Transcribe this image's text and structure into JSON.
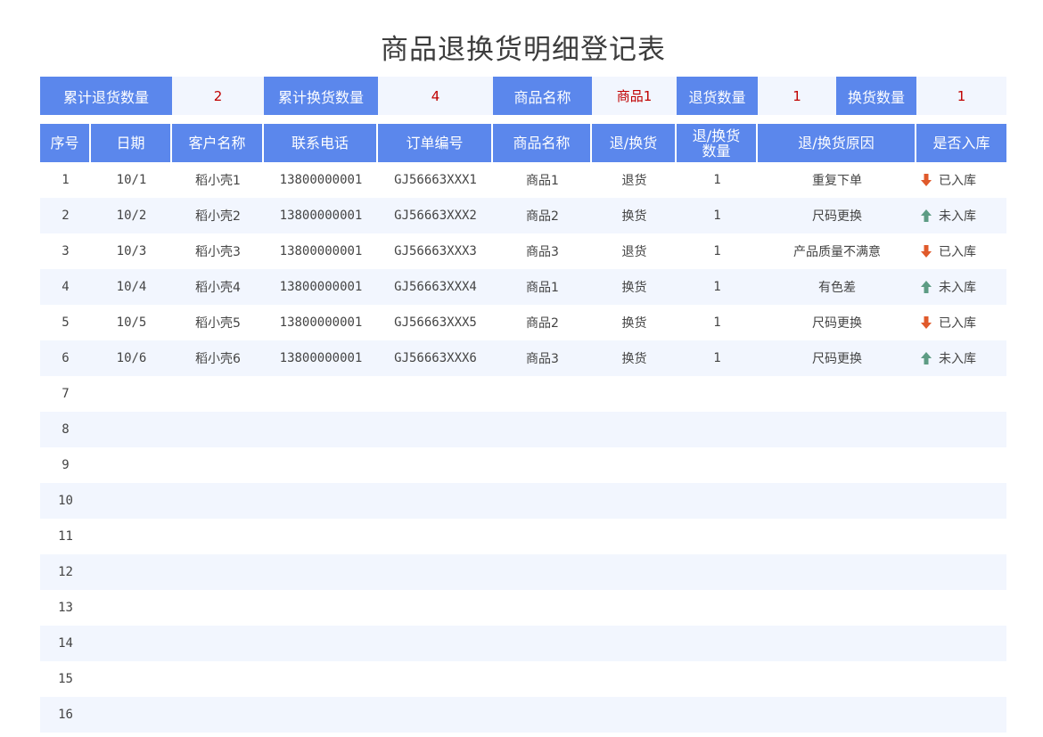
{
  "title": "商品退换货明细登记表",
  "summary": {
    "total_return_label": "累计退货数量",
    "total_return_value": "2",
    "total_exchange_label": "累计换货数量",
    "total_exchange_value": "4",
    "product_label": "商品名称",
    "product_value": "商品1",
    "return_qty_label": "退货数量",
    "return_qty_value": "1",
    "exchange_qty_label": "换货数量",
    "exchange_qty_value": "1"
  },
  "columns": [
    "序号",
    "日期",
    "客户名称",
    "联系电话",
    "订单编号",
    "商品名称",
    "退/换货",
    "退/换货\n数量",
    "退/换货原因",
    "是否入库"
  ],
  "rows": [
    {
      "no": "1",
      "date": "10/1",
      "customer": "稻小壳1",
      "phone": "13800000001",
      "order": "GJ56663XXX1",
      "product": "商品1",
      "type": "退货",
      "qty": "1",
      "reason": "重复下单",
      "stock": "已入库",
      "stock_icon": "arrow-down-icon"
    },
    {
      "no": "2",
      "date": "10/2",
      "customer": "稻小壳2",
      "phone": "13800000001",
      "order": "GJ56663XXX2",
      "product": "商品2",
      "type": "换货",
      "qty": "1",
      "reason": "尺码更换",
      "stock": "未入库",
      "stock_icon": "arrow-up-icon"
    },
    {
      "no": "3",
      "date": "10/3",
      "customer": "稻小壳3",
      "phone": "13800000001",
      "order": "GJ56663XXX3",
      "product": "商品3",
      "type": "退货",
      "qty": "1",
      "reason": "产品质量不满意",
      "stock": "已入库",
      "stock_icon": "arrow-down-icon"
    },
    {
      "no": "4",
      "date": "10/4",
      "customer": "稻小壳4",
      "phone": "13800000001",
      "order": "GJ56663XXX4",
      "product": "商品1",
      "type": "换货",
      "qty": "1",
      "reason": "有色差",
      "stock": "未入库",
      "stock_icon": "arrow-up-icon"
    },
    {
      "no": "5",
      "date": "10/5",
      "customer": "稻小壳5",
      "phone": "13800000001",
      "order": "GJ56663XXX5",
      "product": "商品2",
      "type": "换货",
      "qty": "1",
      "reason": "尺码更换",
      "stock": "已入库",
      "stock_icon": "arrow-down-icon"
    },
    {
      "no": "6",
      "date": "10/6",
      "customer": "稻小壳6",
      "phone": "13800000001",
      "order": "GJ56663XXX6",
      "product": "商品3",
      "type": "换货",
      "qty": "1",
      "reason": "尺码更换",
      "stock": "未入库",
      "stock_icon": "arrow-up-icon"
    },
    {
      "no": "7"
    },
    {
      "no": "8"
    },
    {
      "no": "9"
    },
    {
      "no": "10"
    },
    {
      "no": "11"
    },
    {
      "no": "12"
    },
    {
      "no": "13"
    },
    {
      "no": "14"
    },
    {
      "no": "15"
    },
    {
      "no": "16"
    }
  ],
  "colors": {
    "header": "#5b87ec",
    "stripe": "#f2f6fe",
    "highlight": "#c00000",
    "arrow_down": "#e05a2b",
    "arrow_up": "#5d9c84"
  }
}
